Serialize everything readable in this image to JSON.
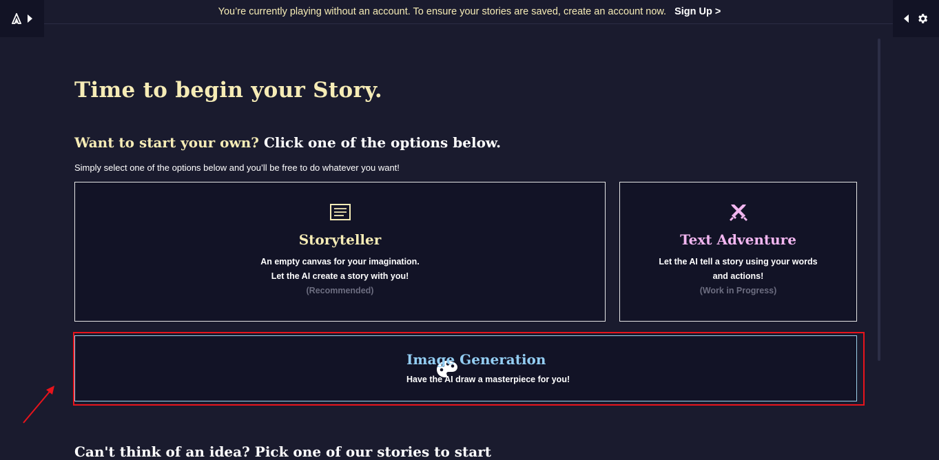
{
  "banner": {
    "message": "You’re currently playing without an account. To ensure your stories are saved, create an account now.",
    "signup_label": "Sign Up >"
  },
  "header": {
    "left_icons": [
      "logo-icon",
      "chevron-right-icon"
    ],
    "right_icons": [
      "chevron-left-icon",
      "gear-icon"
    ]
  },
  "main": {
    "title": "Time to begin your Story.",
    "subtitle_highlight": "Want to start your own?",
    "subtitle_rest": " Click one of the options below.",
    "description": "Simply select one of the options below and you’ll be free to do whatever you want!",
    "cards": {
      "storyteller": {
        "icon": "notes-icon",
        "title": "Storyteller",
        "line1": "An empty canvas for your imagination.",
        "line2": "Let the AI create a story with you!",
        "note": "(Recommended)"
      },
      "text_adventure": {
        "icon": "crossed-swords-icon",
        "title": "Text Adventure",
        "line1": "Let the AI tell a story using your words",
        "line2": "and actions!",
        "note": "(Work in Progress)"
      },
      "image_generation": {
        "icon": "palette-icon",
        "title": "Image Generation",
        "text": "Have the AI draw a masterpiece for you!"
      }
    },
    "next_section_cut": "Can't think of an idea? Pick one of our stories to start"
  },
  "colors": {
    "background": "#1a1b2e",
    "card_background": "#121326",
    "title_yellow": "#f6ecb6",
    "adventure_pink": "#f2b6f0",
    "image_blue": "#93cdf2",
    "highlight_red": "#e8141c"
  }
}
